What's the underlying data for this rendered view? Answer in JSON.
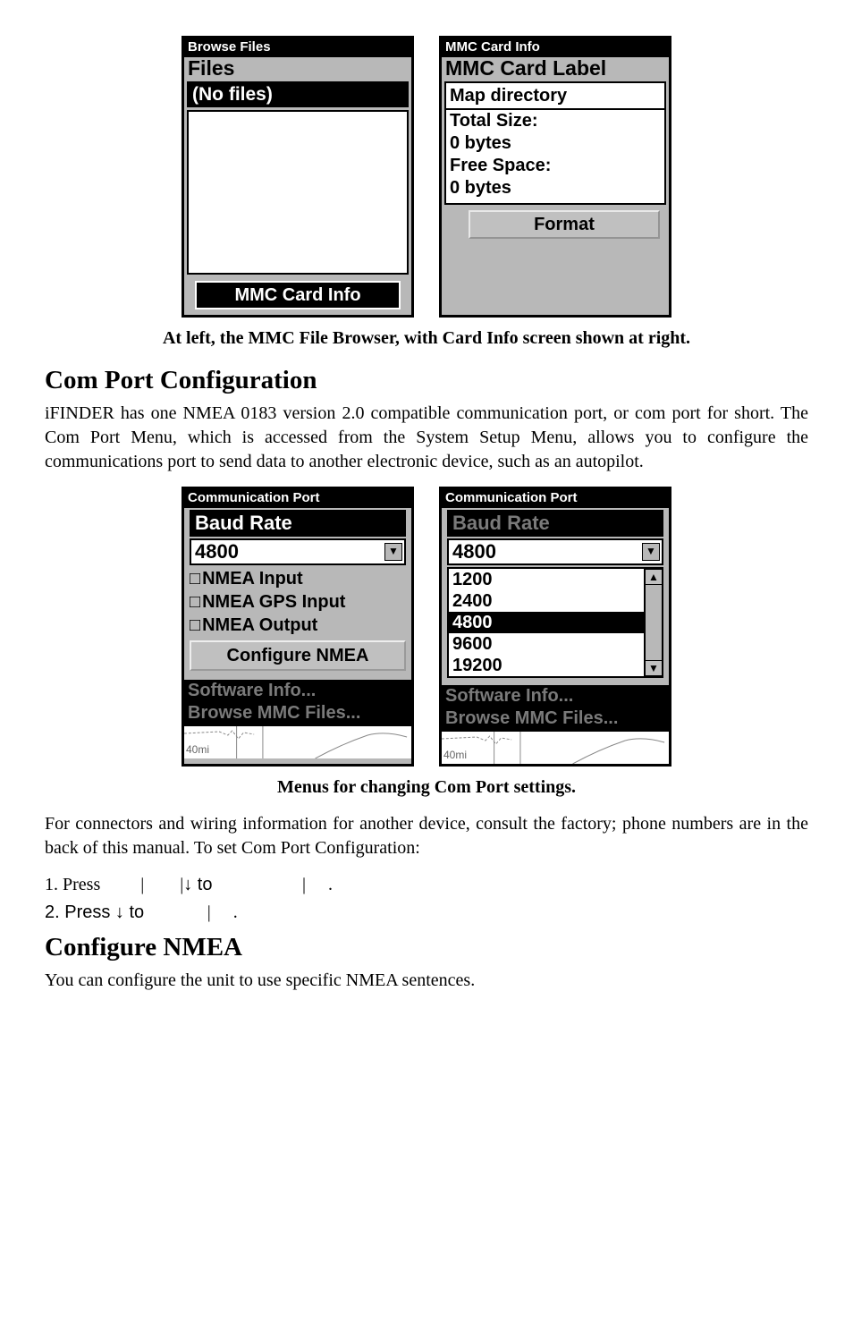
{
  "fig1": {
    "left": {
      "titlebar": "Browse Files",
      "header": "Files",
      "selected": "(No files)",
      "bottom_btn": "MMC Card Info"
    },
    "right": {
      "titlebar": "MMC Card Info",
      "header": "MMC Card Label",
      "line1": "Map directory",
      "line2": "Total Size:",
      "line3": "0 bytes",
      "line4": "Free Space:",
      "line5": "0 bytes",
      "btn": "Format"
    },
    "caption": "At left, the MMC File Browser, with Card Info screen shown at right."
  },
  "h2a": "Com Port Configuration",
  "p1": "iFINDER has one NMEA 0183 version 2.0 compatible communication port, or com port for short. The Com Port Menu, which is accessed from the System Setup Menu, allows you to configure the communications port to send data to another electronic device, such as an autopilot.",
  "fig2": {
    "left": {
      "titlebar": "Communication Port",
      "baud_label": "Baud Rate",
      "baud_value": "4800",
      "chk1": "NMEA Input",
      "chk2": "NMEA GPS Input",
      "chk3": "NMEA Output",
      "conf": "Configure NMEA",
      "menu1": "Software Info...",
      "menu2": "Browse MMC Files...",
      "map_label": "40mi"
    },
    "right": {
      "titlebar": "Communication Port",
      "baud_label": "Baud Rate",
      "baud_value": "4800",
      "opts": [
        "1200",
        "2400",
        "4800",
        "9600",
        "19200"
      ],
      "selected_index": 2,
      "menu1": "Software Info...",
      "menu2": "Browse MMC Files...",
      "map_label": "40mi"
    },
    "caption": "Menus for changing Com Port settings."
  },
  "p2": "For connectors and wiring information for another device, consult the factory; phone numbers are in the back of this manual. To set Com Port Configuration:",
  "step1_a": "1. Press ",
  "step1_b": "↓ to ",
  "step2_a": "2. Press ↓ to ",
  "h2b": "Configure NMEA",
  "p3": "You can configure the unit to use specific NMEA sentences."
}
